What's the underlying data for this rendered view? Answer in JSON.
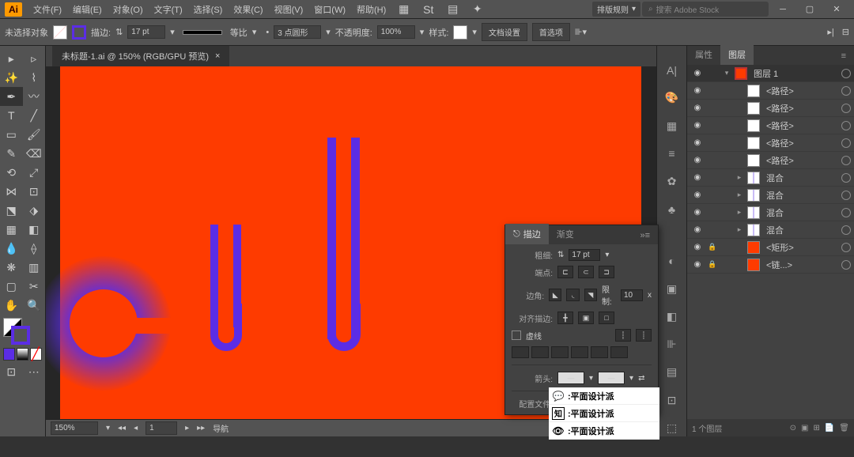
{
  "app": {
    "logo": "Ai"
  },
  "menu": [
    "文件(F)",
    "编辑(E)",
    "对象(O)",
    "文字(T)",
    "选择(S)",
    "效果(C)",
    "视图(V)",
    "窗口(W)",
    "帮助(H)"
  ],
  "top_right": {
    "workspace": "排版规则",
    "search_placeholder": "搜索 Adobe Stock"
  },
  "control": {
    "no_selection": "未选择对象",
    "stroke_label": "描边:",
    "stroke_weight": "17 pt",
    "uniform": "等比",
    "brush_size": "3 点圆形",
    "opacity_label": "不透明度:",
    "opacity": "100%",
    "style_label": "样式:",
    "doc_setup": "文档设置",
    "prefs": "首选项"
  },
  "doc_tab": "未标题-1.ai @ 150% (RGB/GPU 预览)",
  "status": {
    "zoom": "150%",
    "nav": "导航"
  },
  "panel_tabs": {
    "props": "属性",
    "layers": "图层"
  },
  "layer_main": "图层 1",
  "paths": [
    "<路径>",
    "<路径>",
    "<路径>",
    "<路径>",
    "<路径>"
  ],
  "blends": [
    "混合",
    "混合",
    "混合",
    "混合"
  ],
  "rect": "<矩形>",
  "compound": "<链...>",
  "layer_footer": "1 个图层",
  "stroke_panel": {
    "tab_stroke": "描边",
    "tab_gradient": "渐变",
    "weight": "粗细:",
    "weight_val": "17 pt",
    "cap": "端点:",
    "corner": "边角:",
    "limit": "限制:",
    "limit_val": "10",
    "x": "x",
    "align": "对齐描边:",
    "dashed": "虚线",
    "arrows": "箭头:",
    "profile": "配置文件:"
  },
  "social": {
    "name": ":平面设计派"
  }
}
